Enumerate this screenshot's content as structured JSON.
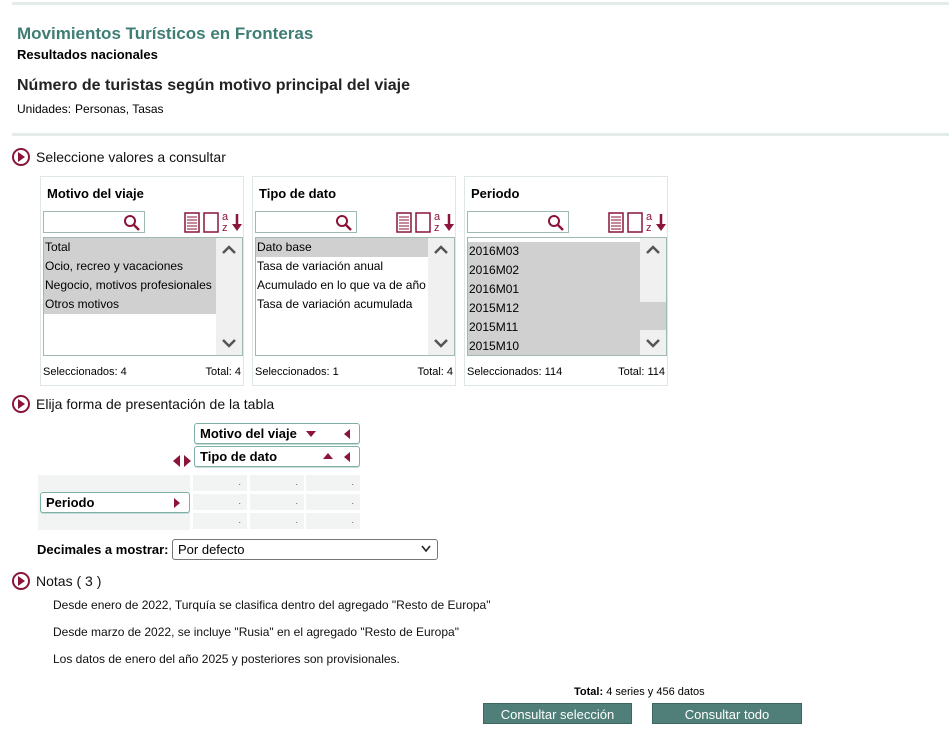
{
  "header": {
    "title": "Movimientos Turísticos en Fronteras",
    "subtitle": "Resultados nacionales",
    "table_title": "Número de turistas según motivo principal del viaje",
    "units_label": "Unidades:",
    "units_value": "Personas, Tasas"
  },
  "sections": {
    "select_values": "Seleccione valores a consultar",
    "presentation": "Elija forma de presentación de la tabla",
    "notes": "Notas ( 3 )"
  },
  "panels": [
    {
      "title": "Motivo del viaje",
      "items": [
        "Total",
        "Ocio, recreo y vacaciones",
        "Negocio, motivos profesionales",
        "Otros motivos"
      ],
      "selected_label": "Seleccionados: 4",
      "total_label": "Total: 4"
    },
    {
      "title": "Tipo de dato",
      "items": [
        "Dato base",
        "Tasa de variación anual",
        "Acumulado en lo que va de año",
        "Tasa de variación acumulada"
      ],
      "selected_label": "Seleccionados: 1",
      "total_label": "Total: 4"
    },
    {
      "title": "Periodo",
      "items": [
        "2016M03",
        "2016M02",
        "2016M01",
        "2015M12",
        "2015M11",
        "2015M10"
      ],
      "selected_label": "Seleccionados: 114",
      "total_label": "Total: 114"
    }
  ],
  "pivot": {
    "col1": "Motivo del viaje",
    "col2": "Tipo de dato",
    "row1": "Periodo",
    "cell": "."
  },
  "decimals": {
    "label": "Decimales a mostrar:",
    "value": "Por defecto"
  },
  "notes": [
    "Desde enero de 2022, Turquía se clasifica dentro del agregado \"Resto de Europa\"",
    "Desde marzo de 2022, se incluye \"Rusia\" en el agregado \"Resto de Europa\"",
    "Los datos de enero del año 2025 y posteriores son provisionales."
  ],
  "footer": {
    "total_label": "Total:",
    "total_series": "4 series y",
    "total_data": "456 datos",
    "btn_selection": "Consultar selección",
    "btn_all": "Consultar todo"
  },
  "colors": {
    "accent": "#3f7e75",
    "icon": "#8a1538",
    "button": "#4f7f78"
  }
}
